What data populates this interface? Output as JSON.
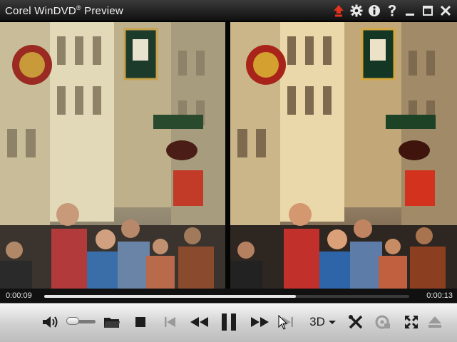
{
  "window": {
    "title": "Corel WinDVD",
    "title_mark": "®",
    "title_suffix": "Preview"
  },
  "titlebar_icons": [
    {
      "name": "upgrade-icon",
      "color": "#e0341f"
    },
    {
      "name": "gear-icon"
    },
    {
      "name": "info-icon"
    },
    {
      "name": "help-icon"
    },
    {
      "name": "minimize-icon"
    },
    {
      "name": "maximize-icon"
    },
    {
      "name": "close-icon"
    }
  ],
  "video": {
    "mode": "side-by-side preview",
    "scene": "crowded old-town shopping street with hanging signs"
  },
  "playback": {
    "elapsed": "0:00:09",
    "total": "0:00:13",
    "progress": 0.69,
    "volume": 0.05
  },
  "controls": {
    "three_d_label": "3D"
  },
  "colors": {
    "titlebar": "#1a1a1a",
    "controlbar": "#d4d4d4",
    "accent_red": "#e0341f",
    "seek_fill": "#e5e5e5"
  }
}
